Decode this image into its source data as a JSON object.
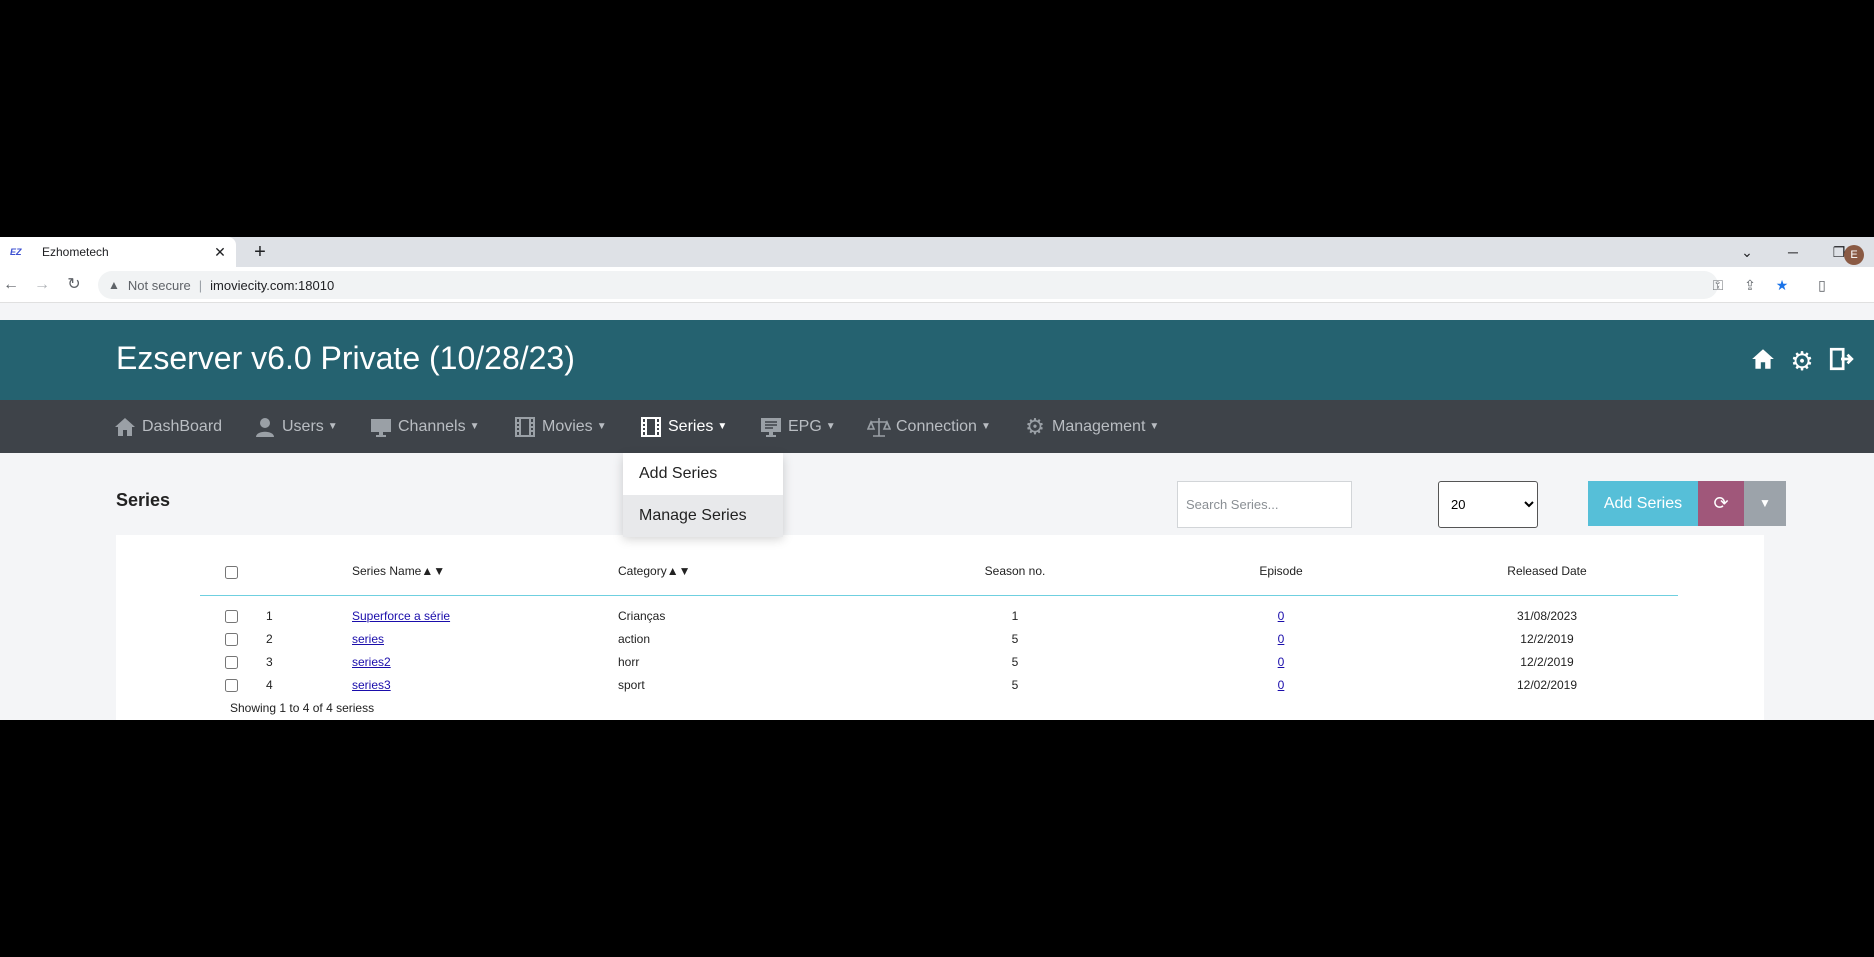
{
  "browser": {
    "tab_title": "Ezhometech",
    "tab_favicon": "EZ",
    "not_secure": "Not secure",
    "url": "imoviecity.com:18010",
    "profile_initial": "E"
  },
  "app": {
    "title": "Ezserver v6.0 Private (10/28/23)"
  },
  "nav": {
    "items": [
      {
        "label": "DashBoard",
        "icon": "home-icon"
      },
      {
        "label": "Users",
        "icon": "user-icon"
      },
      {
        "label": "Channels",
        "icon": "monitor-icon"
      },
      {
        "label": "Movies",
        "icon": "film-icon"
      },
      {
        "label": "Series",
        "icon": "film-icon"
      },
      {
        "label": "EPG",
        "icon": "screen-list-icon"
      },
      {
        "label": "Connection",
        "icon": "scale-icon"
      },
      {
        "label": "Management",
        "icon": "gear-icon"
      }
    ],
    "active": "Series"
  },
  "dropdown": {
    "items": [
      "Add Series",
      "Manage Series"
    ]
  },
  "page": {
    "title": "Series",
    "search_placeholder": "Search Series...",
    "per_page": "20",
    "add_button": "Add Series"
  },
  "table": {
    "columns": {
      "name": "Series Name▲▼",
      "category": "Category▲▼",
      "season": "Season no.",
      "episode": "Episode",
      "released": "Released Date"
    },
    "rows": [
      {
        "index": "1",
        "name": "Superforce a série",
        "category": "Crianças",
        "season": "1",
        "episode": "0",
        "released": "31/08/2023"
      },
      {
        "index": "2",
        "name": "series",
        "category": "action",
        "season": "5",
        "episode": "0",
        "released": "12/2/2019"
      },
      {
        "index": "3",
        "name": "series2",
        "category": "horr",
        "season": "5",
        "episode": "0",
        "released": "12/2/2019"
      },
      {
        "index": "4",
        "name": "series3",
        "category": "sport",
        "season": "5",
        "episode": "0",
        "released": "12/02/2019"
      }
    ],
    "footer": "Showing 1 to 4 of 4 seriess"
  }
}
